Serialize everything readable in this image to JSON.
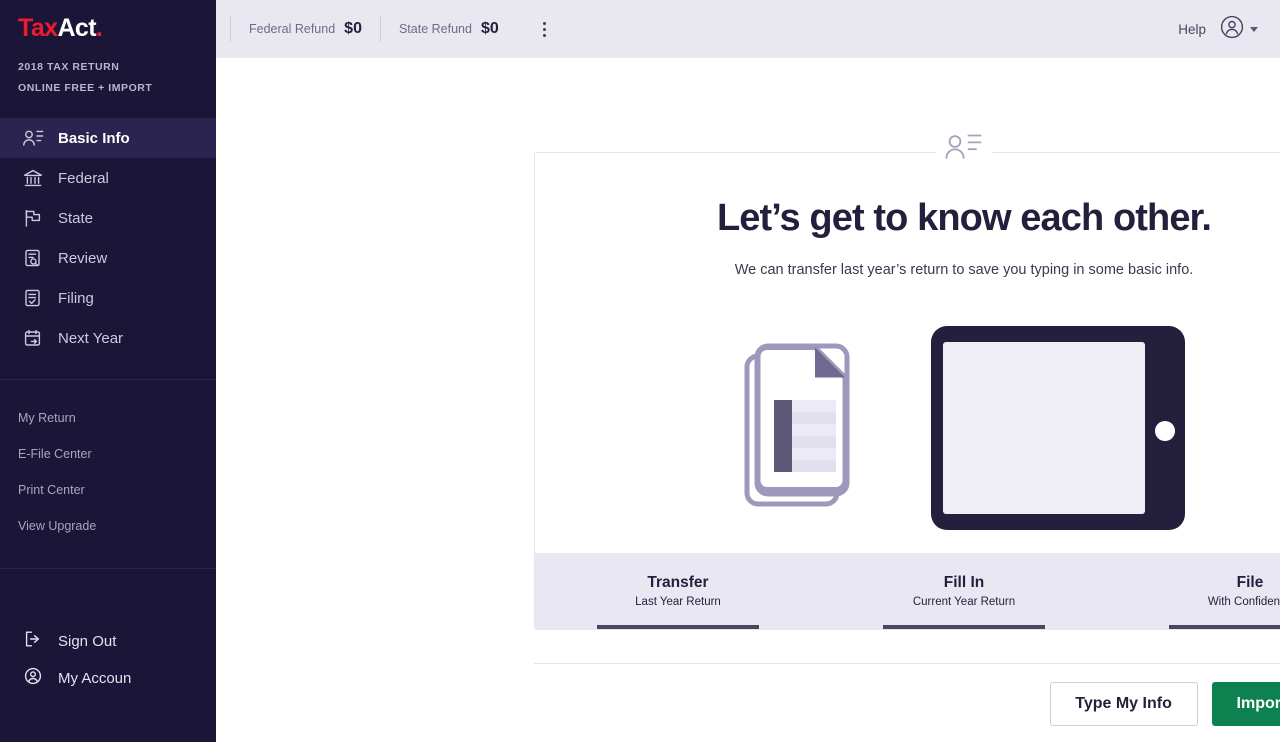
{
  "brand": {
    "name_part1": "Tax",
    "name_part2": "Act",
    "trademark": ".",
    "red": "#ee1b2e"
  },
  "sidebar": {
    "tax_year_line": "2018 TAX RETURN",
    "product_line": "ONLINE FREE + IMPORT",
    "nav": [
      {
        "label": "Basic Info",
        "icon": "contact-card-icon",
        "active": true
      },
      {
        "label": "Federal",
        "icon": "bank-icon",
        "active": false
      },
      {
        "label": "State",
        "icon": "flag-icon",
        "active": false
      },
      {
        "label": "Review",
        "icon": "document-search-icon",
        "active": false
      },
      {
        "label": "Filing",
        "icon": "document-check-icon",
        "active": false
      },
      {
        "label": "Next Year",
        "icon": "calendar-arrow-icon",
        "active": false
      }
    ],
    "links": [
      {
        "label": "My Return"
      },
      {
        "label": "E-File Center"
      },
      {
        "label": "Print Center"
      },
      {
        "label": "View Upgrade"
      }
    ],
    "account": [
      {
        "label": "Sign Out",
        "icon": "sign-out-icon"
      },
      {
        "label": "My Accoun",
        "icon": "user-circle-icon"
      }
    ]
  },
  "topbar": {
    "federal_refund_label": "Federal Refund",
    "federal_refund_value": "$0",
    "state_refund_label": "State Refund",
    "state_refund_value": "$0",
    "menu_icon": "kebab-menu-icon",
    "help_label": "Help",
    "avatar_icon": "user-avatar-icon"
  },
  "card": {
    "top_icon": "contact-card-icon",
    "headline": "Let’s get to know each other.",
    "subhead": "We can transfer last year’s return to save you typing in some basic info.",
    "illustration": {
      "document_icon": "stacked-document-icon",
      "tablet_icon": "tablet-device-icon"
    },
    "steps": [
      {
        "title": "Transfer",
        "subtitle": "Last Year Return"
      },
      {
        "title": "Fill In",
        "subtitle": "Current Year Return"
      },
      {
        "title": "File",
        "subtitle": "With Confidence"
      }
    ]
  },
  "actions": {
    "secondary_label": "Type My Info",
    "primary_label": "Import My Return"
  }
}
